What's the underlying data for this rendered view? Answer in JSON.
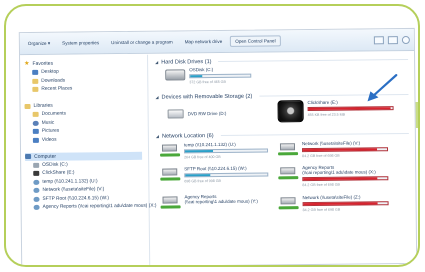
{
  "toolbar": {
    "organize": "Organize ▾",
    "system_properties": "System properties",
    "uninstall": "Uninstall or change a program",
    "map_network": "Map network drive",
    "control_panel": "Open Control Panel"
  },
  "sidebar": {
    "favorites": {
      "label": "Favorites",
      "items": [
        "Desktop",
        "Downloads",
        "Recent Places"
      ]
    },
    "libraries": {
      "label": "Libraries",
      "items": [
        "Documents",
        "Music",
        "Pictures",
        "Videos"
      ]
    },
    "computer": {
      "label": "Computer",
      "items": [
        "OSDisk (C:)",
        "ClickShare (E:)",
        "temp (\\\\10.241.1.132) (U:)",
        "Network (\\\\useta\\siteFile) (V:)",
        "SFTP Root (\\\\10.224.6.15) (W:)",
        "Agency Reports (\\\\cai reporting\\1 adu\\date mous) (X:)"
      ]
    }
  },
  "sections": {
    "hard_disk": "Hard Disk Drives (1)",
    "removable": "Devices with Removable Storage (2)",
    "network": "Network Location (6)"
  },
  "drives": {
    "osdisk": {
      "name": "OSDisk (C:)",
      "sub": "372 GB free of 465 GB",
      "used": 0.2
    },
    "dvd": {
      "name": "DVD RW Drive (D:)"
    },
    "clickshare": {
      "name": "ClickShare (E:)",
      "sub": "455 KB free of 23.5 MB",
      "used": 0.98
    },
    "temp": {
      "name": "temp (\\\\10.241.1.132) (U:)",
      "sub": "264 GB free of 400 GB",
      "used": 0.34
    },
    "network": {
      "name": "Network (\\\\useta\\siteFile) (V:)",
      "sub": "84.2 GB free of 698 GB",
      "used": 0.88
    },
    "sftp": {
      "name": "SFTP Root (\\\\10.224.6.15) (W:)",
      "sub": "698 GB free of 998 GB",
      "used": 0.3
    },
    "agency1": {
      "name": "Agency Reports",
      "sub": "(\\\\cai reporting\\1 adu\\date mous) (X:)",
      "sub2": "84.2 GB free of 698 GB",
      "used": 0.88
    },
    "agency2": {
      "name": "Agency Reports",
      "sub": "(\\\\cai reporting\\1 adu\\date mous) (Y:)"
    },
    "network2": {
      "name": "Network (\\\\useta\\siteFile) (Z:)",
      "sub": "84.2 GB free of 698 GB",
      "used": 0.88
    }
  },
  "colors": {
    "frame": "#b5cf5a",
    "usage_normal": "#2aa0c8",
    "usage_full": "#d8242f",
    "arrow": "#2b6fc4"
  }
}
